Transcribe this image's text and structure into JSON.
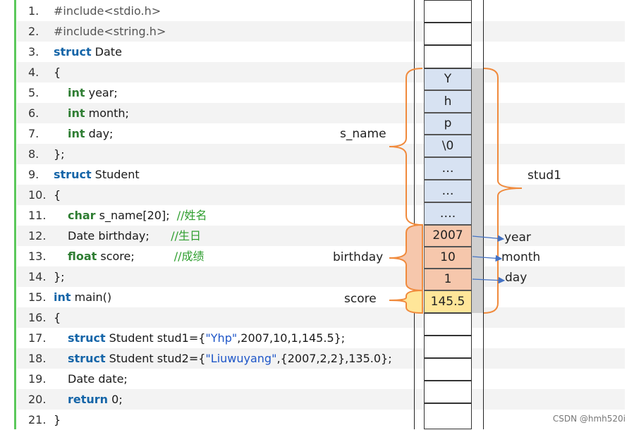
{
  "code_lines": [
    {
      "n": "1.",
      "parts": [
        {
          "t": "#include<stdio.h>",
          "c": "inc"
        }
      ],
      "indent": false
    },
    {
      "n": "2.",
      "parts": [
        {
          "t": "#include<string.h>",
          "c": "inc"
        }
      ],
      "indent": false
    },
    {
      "n": "3.",
      "parts": [
        {
          "t": "struct",
          "c": "kw"
        },
        {
          "t": " Date",
          "c": ""
        }
      ],
      "indent": false
    },
    {
      "n": "4.",
      "parts": [
        {
          "t": "{",
          "c": ""
        }
      ],
      "indent": false
    },
    {
      "n": "5.",
      "parts": [
        {
          "t": "int",
          "c": "kw green"
        },
        {
          "t": " year;",
          "c": ""
        }
      ],
      "indent": true
    },
    {
      "n": "6.",
      "parts": [
        {
          "t": "int",
          "c": "kw green"
        },
        {
          "t": " month;",
          "c": ""
        }
      ],
      "indent": true
    },
    {
      "n": "7.",
      "parts": [
        {
          "t": "int",
          "c": "kw green"
        },
        {
          "t": " day;",
          "c": ""
        }
      ],
      "indent": true
    },
    {
      "n": "8.",
      "parts": [
        {
          "t": "};",
          "c": ""
        }
      ],
      "indent": false
    },
    {
      "n": "9.",
      "parts": [
        {
          "t": "struct",
          "c": "kw"
        },
        {
          "t": " Student",
          "c": ""
        }
      ],
      "indent": false
    },
    {
      "n": "10.",
      "parts": [
        {
          "t": "{",
          "c": ""
        }
      ],
      "indent": false
    },
    {
      "n": "11.",
      "parts": [
        {
          "t": "char",
          "c": "kw green"
        },
        {
          "t": " s_name[20];  ",
          "c": ""
        },
        {
          "t": "//姓名",
          "c": "cmt"
        }
      ],
      "indent": true
    },
    {
      "n": "12.",
      "parts": [
        {
          "t": "Date birthday;      ",
          "c": ""
        },
        {
          "t": "//生日",
          "c": "cmt"
        }
      ],
      "indent": true
    },
    {
      "n": "13.",
      "parts": [
        {
          "t": "float",
          "c": "kw green"
        },
        {
          "t": " score;           ",
          "c": ""
        },
        {
          "t": "//成绩",
          "c": "cmt"
        }
      ],
      "indent": true
    },
    {
      "n": "14.",
      "parts": [
        {
          "t": "};",
          "c": ""
        }
      ],
      "indent": false
    },
    {
      "n": "15.",
      "parts": [
        {
          "t": "int",
          "c": "kw"
        },
        {
          "t": " main()",
          "c": ""
        }
      ],
      "indent": false
    },
    {
      "n": "16.",
      "parts": [
        {
          "t": "{",
          "c": ""
        }
      ],
      "indent": false
    },
    {
      "n": "17.",
      "parts": [
        {
          "t": "struct",
          "c": "kw"
        },
        {
          "t": " Student stud1={",
          "c": ""
        },
        {
          "t": "\"Yhp\"",
          "c": "str"
        },
        {
          "t": ",2007,10,1,145.5};",
          "c": ""
        }
      ],
      "indent": true
    },
    {
      "n": "18.",
      "parts": [
        {
          "t": "struct",
          "c": "kw"
        },
        {
          "t": " Student stud2={",
          "c": ""
        },
        {
          "t": "\"Liuwuyang\"",
          "c": "str"
        },
        {
          "t": ",{2007,2,2},135.0};",
          "c": ""
        }
      ],
      "indent": true
    },
    {
      "n": "19.",
      "parts": [
        {
          "t": "Date date;",
          "c": ""
        }
      ],
      "indent": true
    },
    {
      "n": "20.",
      "parts": [
        {
          "t": "return",
          "c": "kw"
        },
        {
          "t": " 0;",
          "c": ""
        }
      ],
      "indent": true
    },
    {
      "n": "21.",
      "parts": [
        {
          "t": "}",
          "c": ""
        }
      ],
      "indent": false
    }
  ],
  "memory": {
    "s_name_cells": [
      "Y",
      "h",
      "p",
      "\\0",
      "…",
      "…",
      "…."
    ],
    "birthday_cells": [
      "2007",
      "10",
      "1"
    ],
    "score_cell": "145.5",
    "labels": {
      "s_name": "s_name",
      "birthday": "birthday",
      "score": "score",
      "stud1": "stud1",
      "year": "year",
      "month": "month",
      "day": "day"
    }
  },
  "watermark": "CSDN @hmh520i",
  "colors": {
    "brace": "#f08a3c",
    "arrow": "#4472c4",
    "green_bar": "#5bc85b"
  }
}
